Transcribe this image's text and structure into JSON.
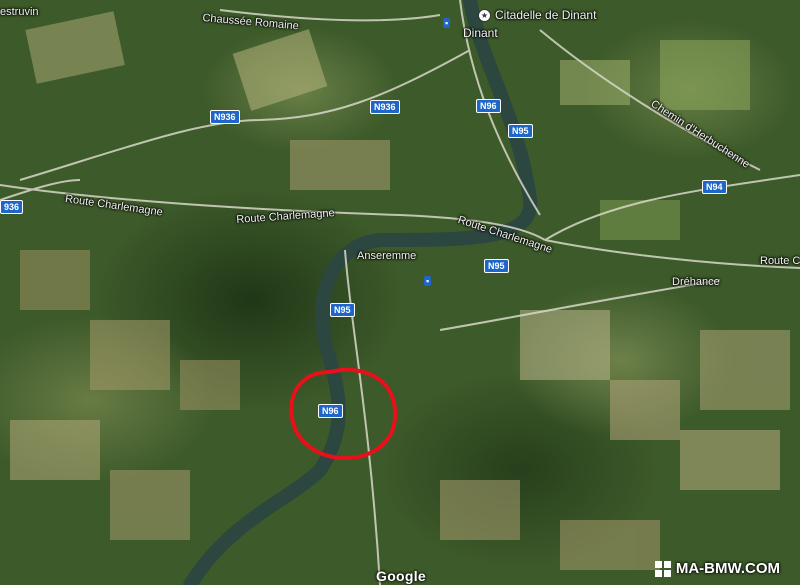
{
  "places": {
    "citadelle": "Citadelle de Dinant",
    "dinant": "Dinant",
    "anseremme": "Anseremme",
    "drehance": "Dréhance",
    "estruvin": "estruvin",
    "chaussee": "Chaussée Romaine",
    "herbuchenne": "Chemin d'Herbuchenne",
    "charlemagne_w": "Route Charlemagne",
    "charlemagne_mid": "Route Charlemagne",
    "charlemagne_e": "Route Charlemagne",
    "route_e": "Route C"
  },
  "shields": {
    "n936_a": "N936",
    "n936_b": "N936",
    "n936_c": "936",
    "n96_a": "N96",
    "n96_b": "N96",
    "n95_a": "N95",
    "n95_b": "N95",
    "n95_c": "N95",
    "n94": "N94"
  },
  "attribution": "Google",
  "watermark": "MA-BMW.COM",
  "highlight_color": "#e8101a"
}
